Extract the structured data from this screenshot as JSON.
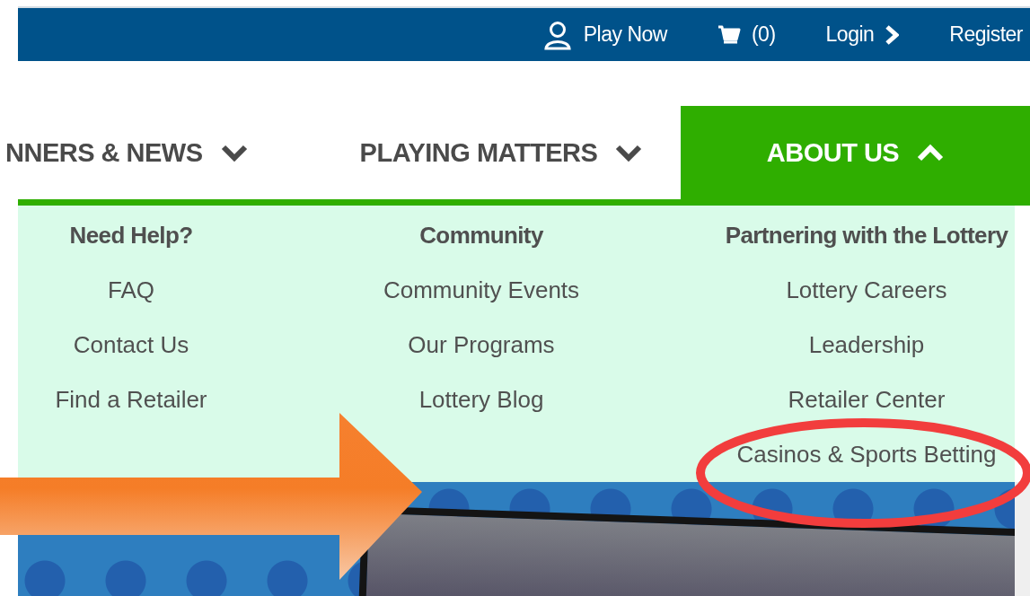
{
  "top_bar": [
    {
      "kind": "account",
      "label": "Play Now"
    },
    {
      "kind": "cart",
      "label": "(0)"
    },
    {
      "kind": "login",
      "label": "Login"
    },
    {
      "kind": "plain",
      "label": "Register"
    }
  ],
  "nav": [
    {
      "label": "NNERS & NEWS",
      "selected": false,
      "expanded": false
    },
    {
      "label": "PLAYING MATTERS",
      "selected": false,
      "expanded": false
    },
    {
      "label": "ABOUT US",
      "selected": true,
      "expanded": true
    }
  ],
  "menu": [
    {
      "heading": "Need Help?",
      "links": [
        "FAQ",
        "Contact Us",
        "Find a Retailer"
      ]
    },
    {
      "heading": "Community",
      "links": [
        "Community Events",
        "Our Programs",
        "Lottery Blog"
      ]
    },
    {
      "heading": "Partnering with the Lottery",
      "links": [
        "Lottery Careers",
        "Leadership",
        "Retailer Center",
        "Casinos & Sports Betting"
      ]
    }
  ]
}
